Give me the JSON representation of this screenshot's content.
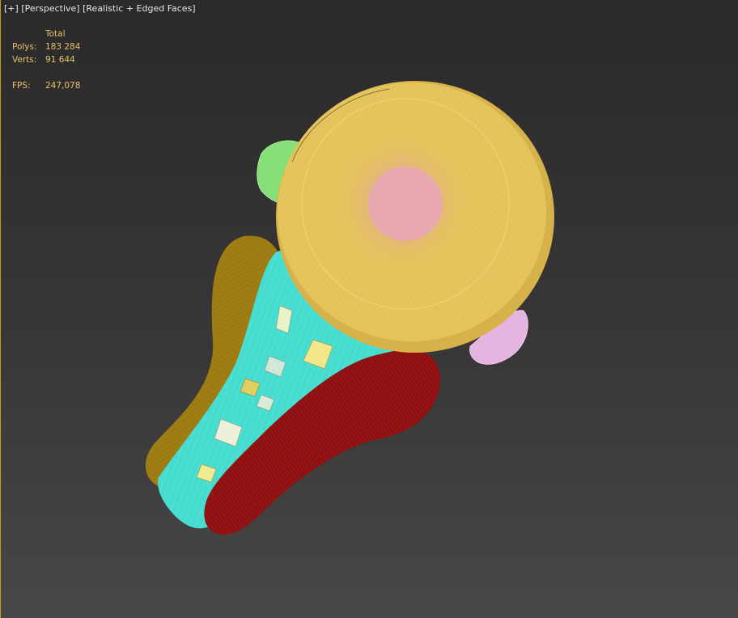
{
  "viewport": {
    "menu_label": "[+]",
    "view_label": "[Perspective]",
    "shading_label": "[Realistic + Edged Faces]"
  },
  "stats": {
    "header": "Total",
    "polys_label": "Polys:",
    "polys_value": "183 284",
    "verts_label": "Verts:",
    "verts_value": "91 644",
    "fps_label": "FPS:",
    "fps_value": "247,078"
  },
  "colors": {
    "stats_text": "#e8c46a",
    "label_text": "#e6e6e6",
    "viewport_border": "#c49a2a",
    "shank_olive": "#9c7c10",
    "band_cyan": "#46dcd0",
    "shank_red": "#8e0f0f",
    "head_gold": "#e4c458",
    "center_pink": "#e6a8b0",
    "prong_green": "#86e07a",
    "prong_pink": "#e6b4e0"
  },
  "objects": [
    {
      "name": "ring-shank-olive"
    },
    {
      "name": "ring-band-cyan"
    },
    {
      "name": "ring-shank-red"
    },
    {
      "name": "ring-head-gold"
    },
    {
      "name": "prong-green"
    },
    {
      "name": "prong-pink"
    }
  ]
}
